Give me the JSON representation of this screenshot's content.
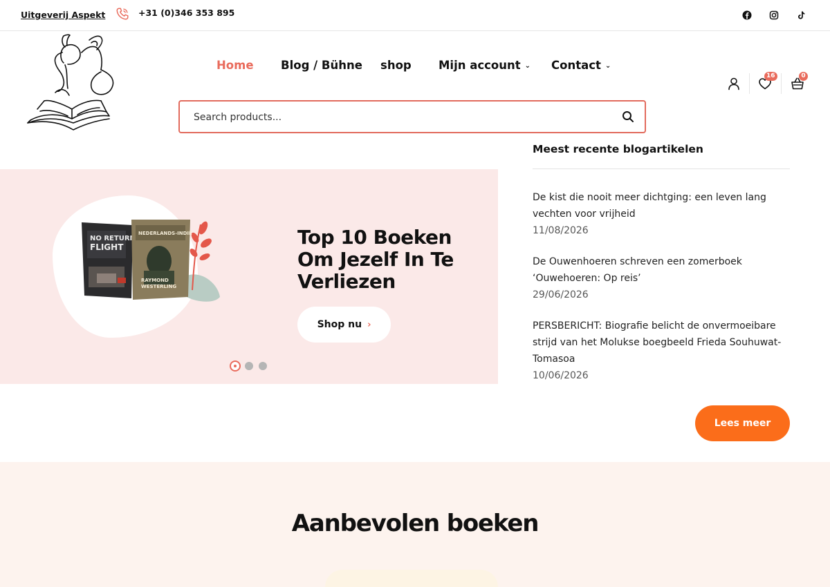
{
  "topbar": {
    "brand": "Uitgeverij Aspekt",
    "phone": "+31 (0)346 353 895",
    "social": [
      "facebook-icon",
      "instagram-icon",
      "tiktok-icon"
    ]
  },
  "nav": {
    "items": [
      {
        "label": "Home",
        "active": true
      },
      {
        "label": "Blog / Bühne"
      },
      {
        "label": "shop"
      },
      {
        "label": "Mijn account",
        "dropdown": true
      },
      {
        "label": "Contact",
        "dropdown": true
      }
    ]
  },
  "search": {
    "placeholder": "Search products..."
  },
  "header_icons": {
    "wishlist_count": "16",
    "cart_count": "0"
  },
  "hero": {
    "title": "Top 10 Boeken Om Jezelf In Te Verliezen",
    "button": "Shop nu",
    "slides": 3,
    "active_slide": 1,
    "background": "#fbe9e8"
  },
  "blog": {
    "heading": "Meest recente blogartikelen",
    "posts": [
      {
        "title": "De kist die nooit meer dichtging: een leven lang vechten voor vrijheid",
        "date": "11/08/2026"
      },
      {
        "title": "De Ouwenhoeren schreven een zomerboek ‘Ouwehoeren: Op reis’",
        "date": "29/06/2026"
      },
      {
        "title": "PERSBERICHT: Biografie belicht de onvermoeibare strijd van het Molukse boegbeeld Frieda Souhuwat-Tomasoa",
        "date": "10/06/2026"
      }
    ],
    "more_button": "Lees meer"
  },
  "recommended": {
    "title": "Aanbevolen boeken"
  },
  "colors": {
    "accent": "#e96b5c",
    "cta": "#fb6d1a",
    "hero_bg": "#fbe9e8",
    "section_bg": "#fdf3ee"
  }
}
